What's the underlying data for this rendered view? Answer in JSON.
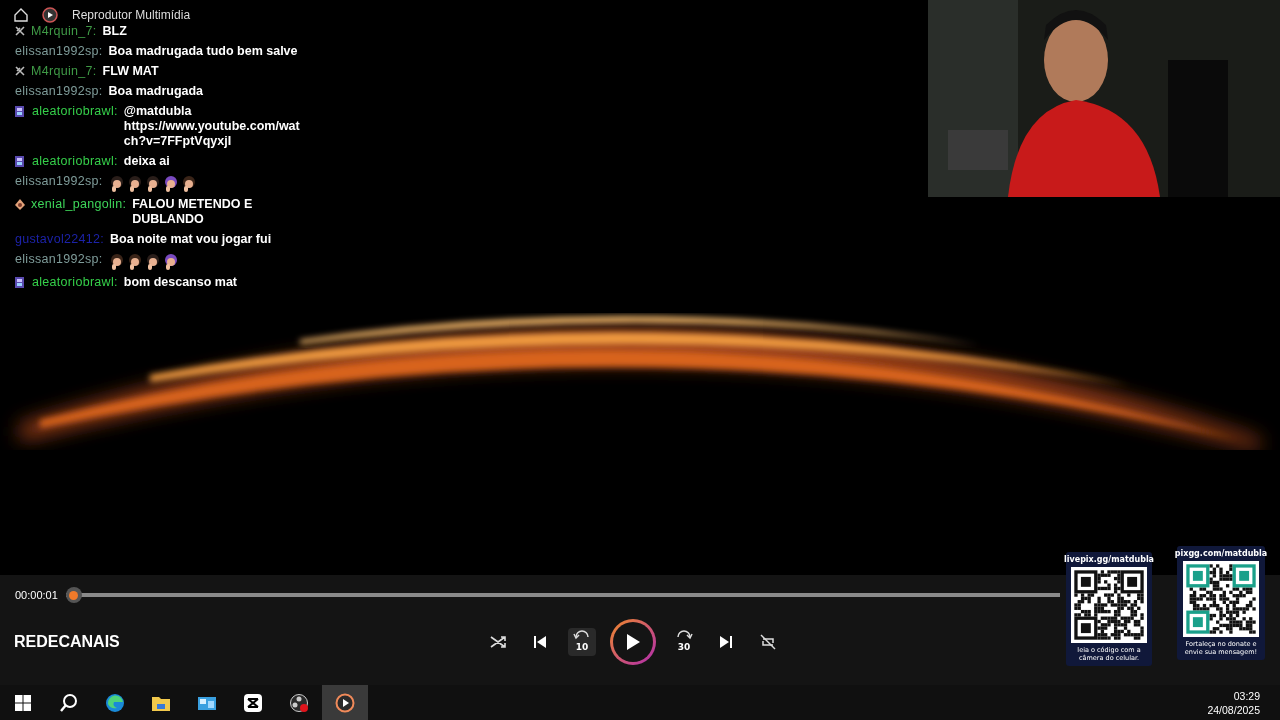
{
  "window": {
    "title": "Reprodutor Multimídia"
  },
  "chat": [
    {
      "badge": {
        "kind": "mod"
      },
      "user": "M4rquin_7:",
      "color": "#3f9a46",
      "text": "BLZ"
    },
    {
      "user": "elissan1992sp:",
      "color": "#7f9c9a",
      "text": "Boa madrugada tudo bem salve"
    },
    {
      "badge": {
        "kind": "mod"
      },
      "user": "M4rquin_7:",
      "color": "#3f9a46",
      "text": "FLW MAT"
    },
    {
      "user": "elissan1992sp:",
      "color": "#7f9c9a",
      "text": "Boa madrugada"
    },
    {
      "badge": {
        "kind": "sub"
      },
      "user": "aleatoriobrawl:",
      "color": "#35d04a",
      "text": "@matdubla https://www.youtube.com/watch?v=7FFptVqyxjI"
    },
    {
      "badge": {
        "kind": "sub"
      },
      "user": "aleatoriobrawl:",
      "color": "#35d04a",
      "text": "deixa ai"
    },
    {
      "user": "elissan1992sp:",
      "color": "#7f9c9a",
      "emotes": [
        {
          "kind": "woman"
        },
        {
          "kind": "woman"
        },
        {
          "kind": "woman"
        },
        {
          "kind": "girl"
        },
        {
          "kind": "man"
        }
      ]
    },
    {
      "badge": {
        "kind": "gem"
      },
      "user": "xenial_pangolin:",
      "color": "#3ed65a",
      "text": "FALOU METENDO E DUBLANDO"
    },
    {
      "user": "gustavol22412:",
      "color": "#1c22a8",
      "text": "Boa noite mat vou jogar fui"
    },
    {
      "user": "elissan1992sp:",
      "color": "#7f9c9a",
      "emotes": [
        {
          "kind": "man"
        },
        {
          "kind": "man"
        },
        {
          "kind": "woman"
        },
        {
          "kind": "girl"
        }
      ]
    },
    {
      "badge": {
        "kind": "sub"
      },
      "user": "aleatoriobrawl:",
      "color": "#35d04a",
      "text": "bom descanso mat"
    }
  ],
  "player": {
    "time": "00:00:01",
    "level": 0.0,
    "title": "REDECANAIS",
    "rewind_label": "10",
    "forward_label": "30",
    "playing": false
  },
  "donations": [
    {
      "header": "livepix.gg/matdubla",
      "caption": "leia o código com a câmera do celular.",
      "kind": "livepix"
    },
    {
      "header": "pixgg.com/matdubla",
      "caption": "Fortaleça no donate e envie sua mensagem!",
      "kind": "pixgg"
    }
  ],
  "taskbar": {
    "apps": [
      {
        "kind": "start",
        "selected": false
      },
      {
        "kind": "search",
        "selected": false
      },
      {
        "kind": "edge",
        "selected": false
      },
      {
        "kind": "folder",
        "selected": false
      },
      {
        "kind": "weather",
        "selected": false
      },
      {
        "kind": "capcut",
        "selected": false
      },
      {
        "kind": "obs",
        "selected": false
      },
      {
        "kind": "player",
        "selected": true
      }
    ],
    "time": "03:29",
    "date": "24/08/2025"
  }
}
